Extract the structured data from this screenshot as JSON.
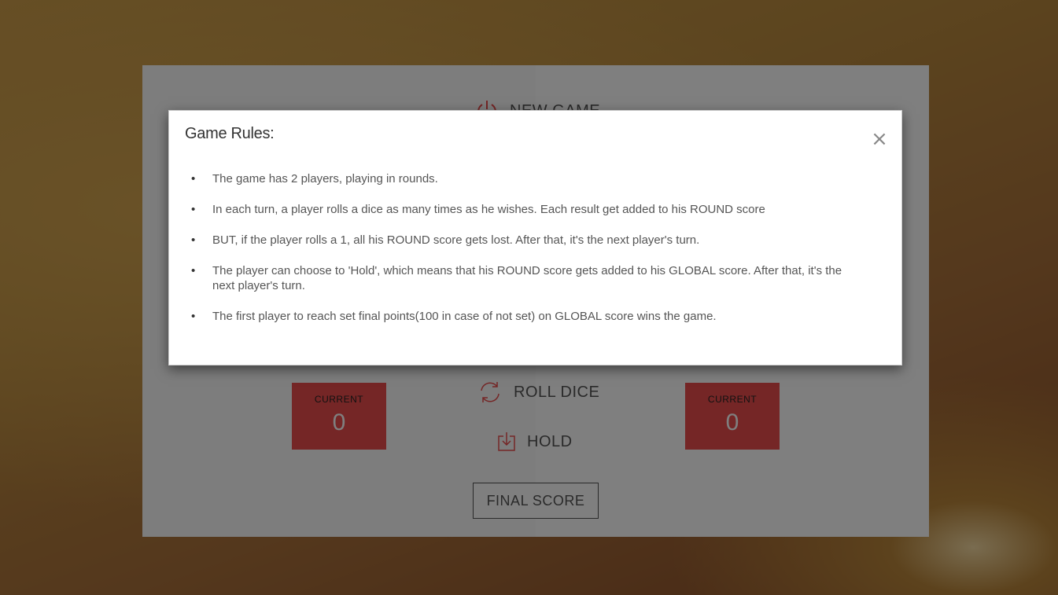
{
  "board": {
    "new_game_label": "NEW GAME",
    "player1": {
      "current_label": "CURRENT",
      "current_score": "0"
    },
    "player2": {
      "current_label": "CURRENT",
      "current_score": "0"
    },
    "roll_dice_label": "ROLL DICE",
    "hold_label": "HOLD",
    "final_score_label": "FINAL SCORE",
    "accent_color": "#eb4d4d"
  },
  "modal": {
    "title": "Game Rules:",
    "close_symbol": "×",
    "rules": [
      "The game has 2 players, playing in rounds.",
      "In each turn, a player rolls a dice as many times as he wishes. Each result get added to his ROUND score",
      "BUT, if the player rolls a 1, all his ROUND score gets lost. After that, it's the next player's turn.",
      "The player can choose to 'Hold', which means that his ROUND score gets added to his GLOBAL score. After that, it's the next player's turn.",
      "The first player to reach set final points(100 in case of not set) on GLOBAL score wins the game."
    ]
  }
}
